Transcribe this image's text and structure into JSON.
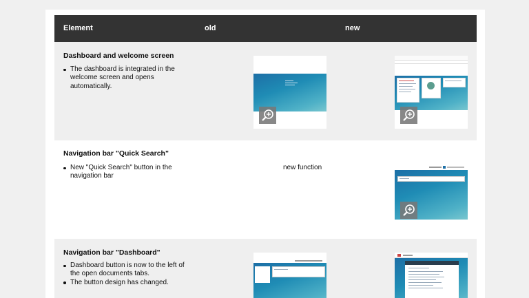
{
  "table": {
    "headers": {
      "element": "Element",
      "old": "old",
      "new": "new"
    },
    "rows": [
      {
        "title": "Dashboard and welcome screen",
        "bullets": [
          "The dashboard is integrated in the welcome screen and opens automatically."
        ],
        "old_note": ""
      },
      {
        "title": "Navigation bar \"Quick Search\"",
        "bullets": [
          "New \"Quick Search\" button in the navigation bar"
        ],
        "old_note": "new function"
      },
      {
        "title": "Navigation bar \"Dashboard\"",
        "bullets": [
          "Dashboard button is now to the left of the open documents tabs.",
          "The button design has changed."
        ],
        "old_note": ""
      }
    ]
  },
  "icons": {
    "zoom": "zoom-in-icon"
  },
  "colors": {
    "header_bg": "#333333",
    "shade_row": "#efefef",
    "gradient_start": "#1d6fa6",
    "gradient_end": "#79c6cf"
  }
}
